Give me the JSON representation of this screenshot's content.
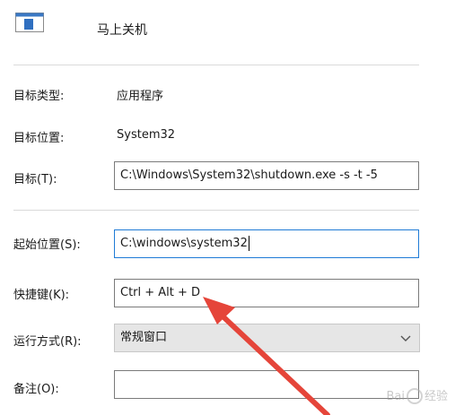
{
  "header": {
    "title": "马上关机"
  },
  "fields": {
    "target_type": {
      "label": "目标类型:",
      "value": "应用程序"
    },
    "target_location": {
      "label": "目标位置:",
      "value": "System32"
    },
    "target": {
      "label": "目标(T):",
      "value": "C:\\Windows\\System32\\shutdown.exe -s -t -5"
    },
    "start_in": {
      "label": "起始位置(S):",
      "value": "C:\\windows\\system32"
    },
    "shortcut_key": {
      "label": "快捷键(K):",
      "value": "Ctrl + Alt + D"
    },
    "run": {
      "label": "运行方式(R):",
      "value": "常规窗口"
    },
    "comment": {
      "label": "备注(O):",
      "value": ""
    }
  },
  "watermark": {
    "text_left": "Bai",
    "text_right": "经验"
  },
  "colors": {
    "accent": "#1f7bd6",
    "arrow": "#e5453a"
  }
}
